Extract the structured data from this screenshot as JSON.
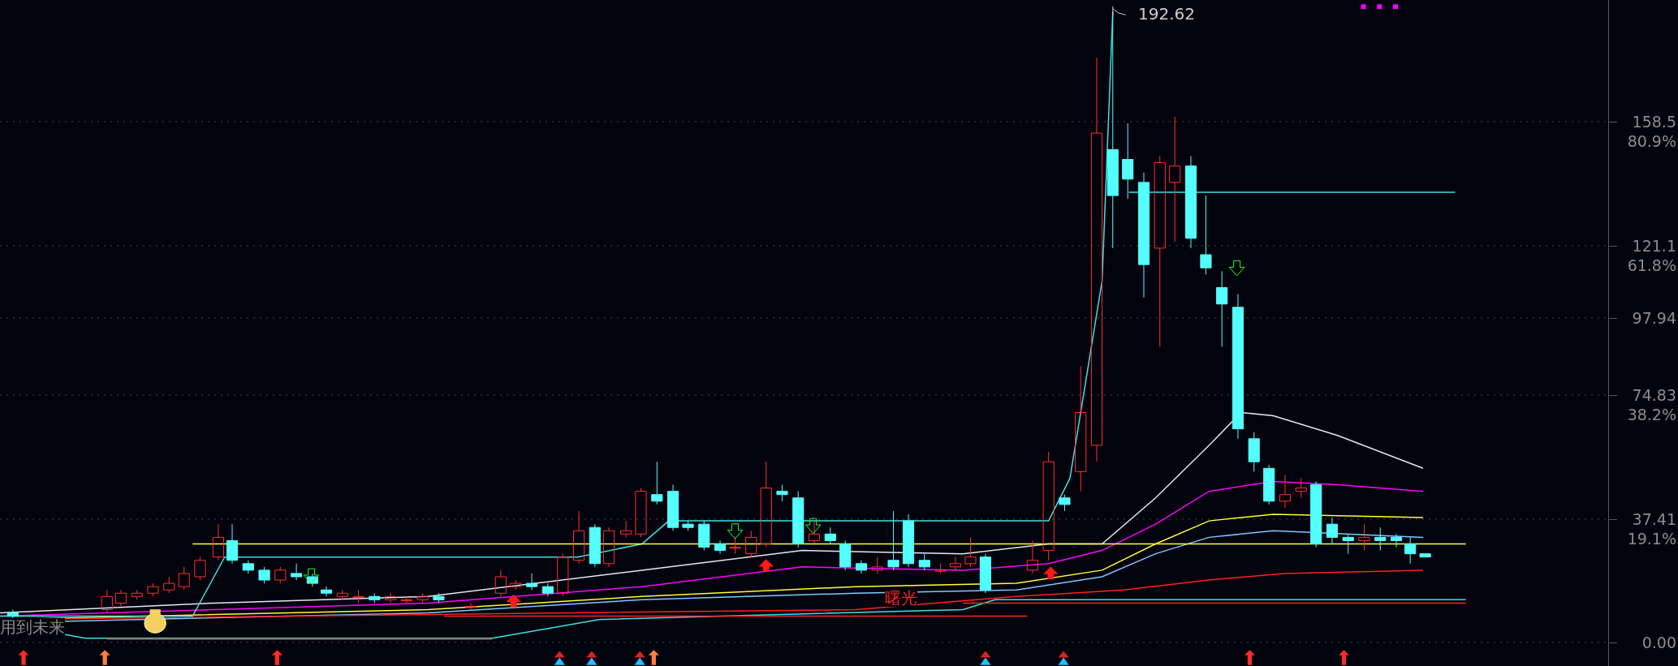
{
  "peak_label": "192.62",
  "axis": [
    {
      "price": "158.5",
      "percent": "80.9%"
    },
    {
      "price": "121.1",
      "percent": "61.8%"
    },
    {
      "price": "97.94"
    },
    {
      "price": "74.83",
      "percent": "38.2%"
    },
    {
      "price": "37.41",
      "percent": "19.1%"
    },
    {
      "price": "0.00"
    }
  ],
  "annotations": [
    {
      "text": "曙光"
    },
    {
      "text": "用到未来"
    }
  ]
}
